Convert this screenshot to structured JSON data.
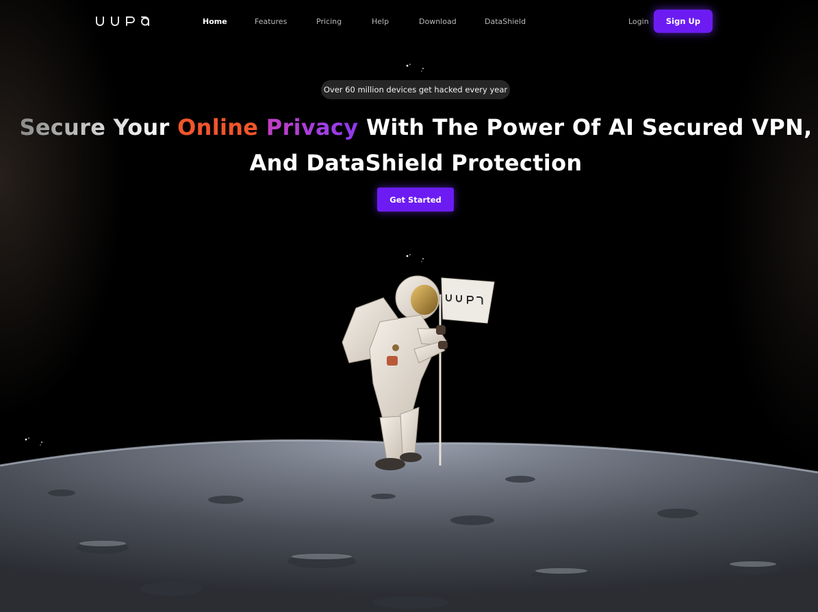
{
  "brand": {
    "logo_text": "ᑌ U ᖇ ᗩ",
    "flag_logo_text": "ᑌ U ᖇ ᗩ"
  },
  "nav": {
    "links": [
      {
        "label": "Home",
        "active": true
      },
      {
        "label": "Features",
        "active": false
      },
      {
        "label": "Pricing",
        "active": false
      },
      {
        "label": "Help",
        "active": false
      },
      {
        "label": "Download",
        "active": false
      },
      {
        "label": "DataShield",
        "active": false
      }
    ],
    "login_label": "Login",
    "signup_label": "Sign Up"
  },
  "hero": {
    "badge": "Over 60 million devices get hacked every year",
    "headline": {
      "secure_your": "Secure Your",
      "online": "Online",
      "privacy": "Privacy",
      "line1_rest": "With The Power Of AI Secured VPN,",
      "line2": "And DataShield Protection"
    },
    "cta_label": "Get Started"
  },
  "colors": {
    "accent": "#6c1cf2",
    "online_orange": "#f0552b",
    "privacy_purple": "#a23fe0",
    "badge_bg": "#262626",
    "background": "#000000"
  },
  "icons": {
    "sparkle": "sparkle-icon",
    "astronaut": "astronaut-illustration",
    "moon": "moon-surface-illustration"
  }
}
